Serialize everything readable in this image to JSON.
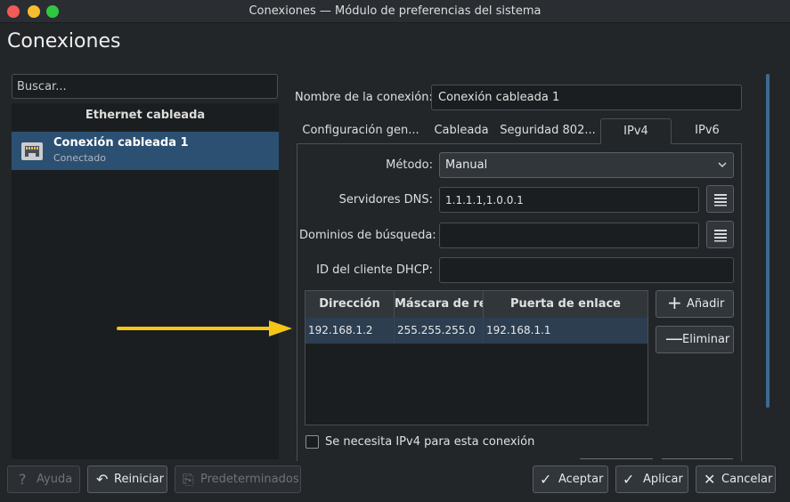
{
  "window": {
    "title": "Conexiones — Módulo de preferencias del sistema",
    "header": "Conexiones"
  },
  "sidebar": {
    "search_placeholder": "Buscar...",
    "group_header": "Ethernet cableada",
    "connections": [
      {
        "name": "Conexión cableada 1",
        "status": "Conectado",
        "icon": "ethernet-port-icon"
      }
    ]
  },
  "details": {
    "connection_name_label": "Nombre de la conexión:",
    "connection_name_value": "Conexión cableada 1",
    "tabs": [
      "Configuración gen...",
      "Cableada",
      "Seguridad 802...",
      "IPv4",
      "IPv6"
    ],
    "active_tab": "IPv4",
    "method_label": "Método:",
    "method_value": "Manual",
    "dns_label": "Servidores DNS:",
    "dns_value": "1.1.1.1,1.0.0.1",
    "search_domains_label": "Dominios de búsqueda:",
    "search_domains_value": "",
    "dhcp_id_label": "ID del cliente DHCP:",
    "dhcp_id_value": "",
    "table": {
      "columns": [
        "Dirección",
        "Máscara de red",
        "Puerta de enlace"
      ],
      "rows": [
        [
          "192.168.1.2",
          "255.255.255.0",
          "192.168.1.1"
        ]
      ]
    },
    "add_button": "Añadir",
    "remove_button": "Eliminar",
    "require_ipv4_label": "Se necesita IPv4 para esta conexión",
    "require_ipv4_checked": false
  },
  "footer": {
    "help": "Ayuda",
    "reset": "Reiniciar",
    "defaults": "Predeterminados",
    "ok": "Aceptar",
    "apply": "Aplicar",
    "cancel": "Cancelar"
  },
  "colors": {
    "background": "#232629",
    "selection": "#2c5072",
    "annotation_arrow": "#f5c518"
  }
}
